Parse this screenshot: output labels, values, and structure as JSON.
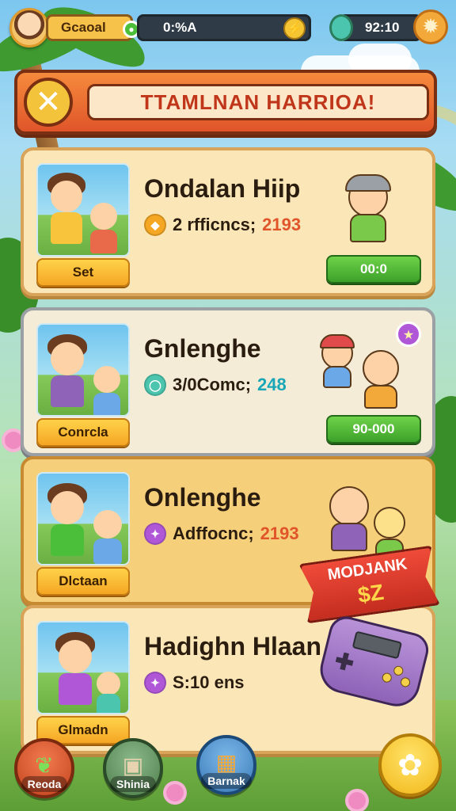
{
  "hud": {
    "player_name": "Gcaoal",
    "progress_text": "0:%A",
    "timer_text": "92:10"
  },
  "title": "TTAMLNAN HARRIOA!",
  "cards": [
    {
      "title": "Ondalan Hiip",
      "reward_text": "2 rfficncs;",
      "reward_value": "2193",
      "button": "Set",
      "action": "00:0"
    },
    {
      "title": "Gnlenghe",
      "reward_text": "3/0Comc;",
      "reward_value": "248",
      "button": "Conrcla",
      "action": "90-000"
    },
    {
      "title": "Onlenghe",
      "reward_text": "Adffocnc;",
      "reward_value": "2193",
      "button": "Dlctaan"
    },
    {
      "title": "Hadighn Hlaan",
      "reward_text": "S:10 ens",
      "button": "Glmadn"
    }
  ],
  "promo": {
    "title": "MODJANK",
    "price": "$Z"
  },
  "nav": {
    "item1": "Reoda",
    "item2": "Shinia",
    "item3": "Barnak"
  },
  "colors": {
    "accent_orange": "#e0552a",
    "card_bg": "#fbe6b8",
    "action_green": "#3ca12a",
    "gold": "#f5a623"
  },
  "icons": [
    "settings-icon",
    "close-icon",
    "leaf-icon",
    "box-icon",
    "chest-icon",
    "flower-icon",
    "coin-icon",
    "gem-icon"
  ]
}
